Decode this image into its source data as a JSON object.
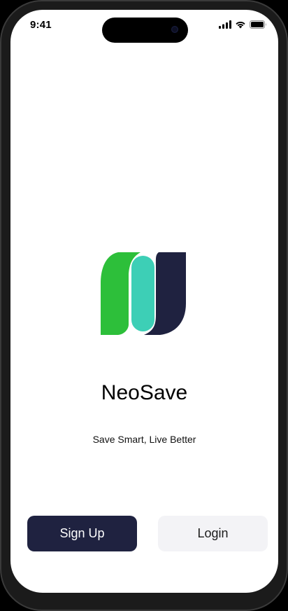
{
  "status_bar": {
    "time": "9:41",
    "icons": [
      "cellular-signal-icon",
      "wifi-icon",
      "battery-icon"
    ]
  },
  "app": {
    "logo_name": "neosave-logo",
    "name": "NeoSave",
    "tagline": "Save Smart, Live Better"
  },
  "actions": {
    "signup_label": "Sign Up",
    "login_label": "Login"
  },
  "colors": {
    "logo_green": "#2dbf3a",
    "logo_teal": "#3dcfb6",
    "logo_navy": "#1f2240",
    "signup_bg": "#1f2240",
    "login_bg": "#f3f3f6"
  }
}
